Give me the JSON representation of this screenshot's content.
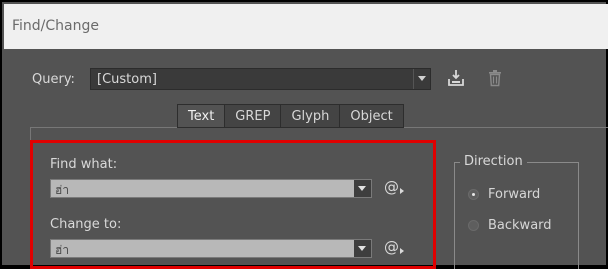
{
  "window": {
    "title": "Find/Change"
  },
  "query": {
    "label": "Query:",
    "value": "[Custom]",
    "icons": [
      "save-query-icon",
      "delete-query-icon"
    ]
  },
  "tabs": [
    {
      "label": "Text",
      "active": true
    },
    {
      "label": "GREP",
      "active": false
    },
    {
      "label": "Glyph",
      "active": false
    },
    {
      "label": "Object",
      "active": false
    }
  ],
  "find": {
    "label": "Find what:",
    "value": "ฮ่า"
  },
  "change": {
    "label": "Change to:",
    "value": "ฮ่า"
  },
  "special_char_button": "@",
  "direction": {
    "legend": "Direction",
    "options": [
      {
        "label": "Forward",
        "selected": true
      },
      {
        "label": "Backward",
        "selected": false
      }
    ]
  },
  "colors": {
    "highlight": "#e00000",
    "panel_bg": "#535353",
    "titlebar_bg": "#f0f0f0"
  }
}
